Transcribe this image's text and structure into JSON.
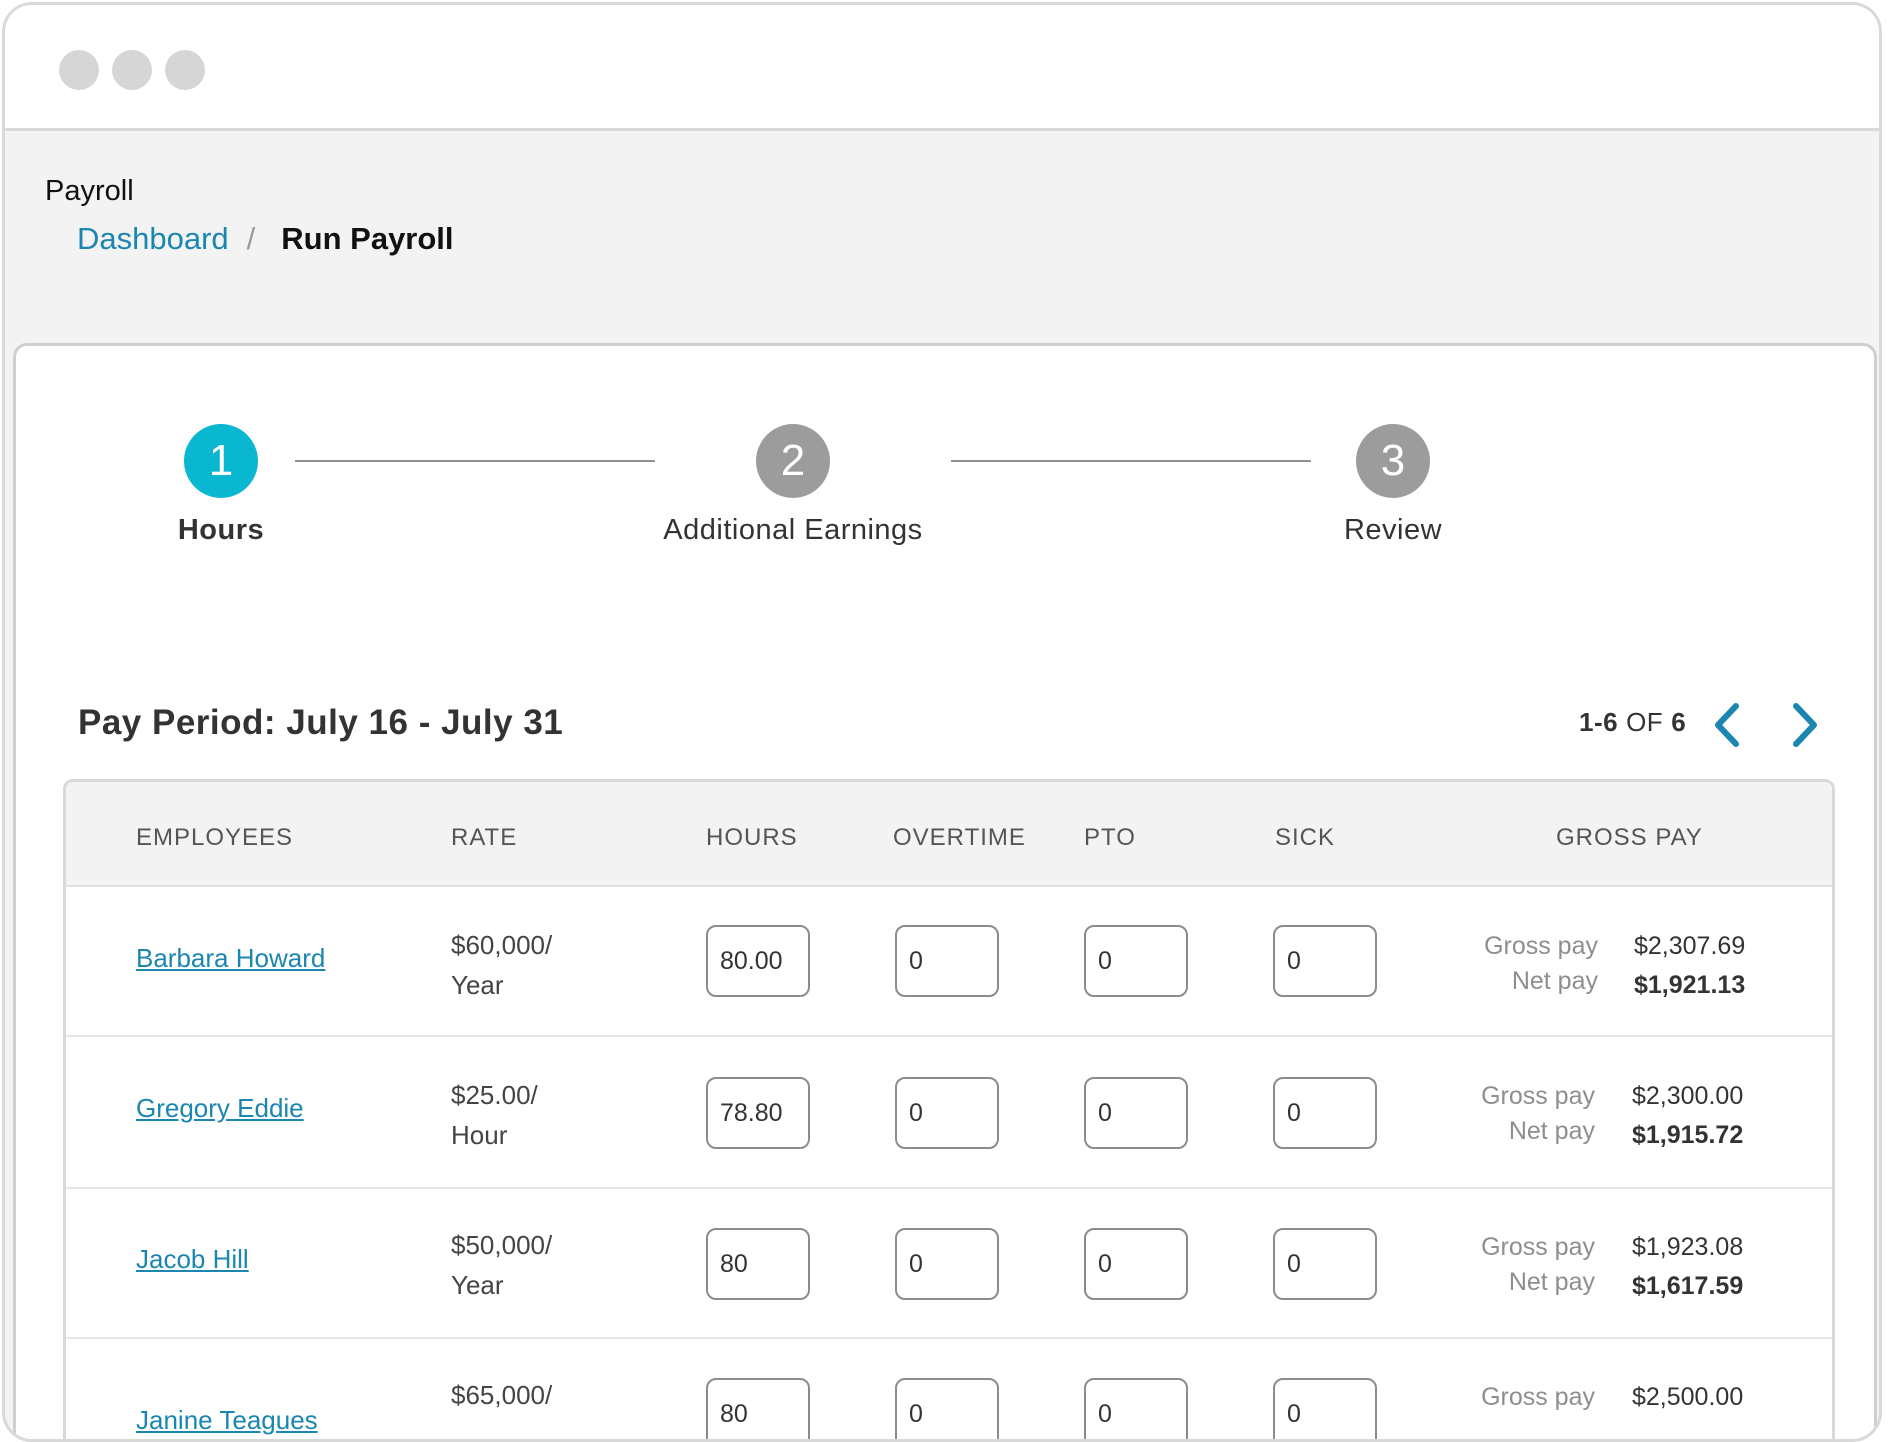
{
  "app": {
    "title": "Payroll",
    "breadcrumb": {
      "link": "Dashboard",
      "separator": "/",
      "current": "Run Payroll"
    }
  },
  "steps": [
    {
      "number": "1",
      "label": "Hours",
      "state": "active"
    },
    {
      "number": "2",
      "label": "Additional Earnings",
      "state": "inactive"
    },
    {
      "number": "3",
      "label": "Review",
      "state": "inactive"
    }
  ],
  "pay_period": {
    "title": "Pay Period: July 16 - July 31"
  },
  "pagination": {
    "range": "1-6",
    "of": "OF",
    "total": "6"
  },
  "table": {
    "headers": [
      "EMPLOYEES",
      "RATE",
      "HOURS",
      "OVERTIME",
      "PTO",
      "SICK",
      "GROSS PAY"
    ],
    "gross_label": "Gross pay",
    "net_label": "Net pay",
    "rows": [
      {
        "name": "Barbara Howard",
        "rate_amount": "$60,000/",
        "rate_unit": "Year",
        "hours": "80.00",
        "overtime": "0",
        "pto": "0",
        "sick": "0",
        "gross": "$2,307.69",
        "net": "$1,921.13"
      },
      {
        "name": "Gregory Eddie",
        "rate_amount": "$25.00/",
        "rate_unit": "Hour",
        "hours": "78.80",
        "overtime": "0",
        "pto": "0",
        "sick": "0",
        "gross": "$2,300.00",
        "net": "$1,915.72"
      },
      {
        "name": "Jacob Hill",
        "rate_amount": "$50,000/",
        "rate_unit": "Year",
        "hours": "80",
        "overtime": "0",
        "pto": "0",
        "sick": "0",
        "gross": "$1,923.08",
        "net": "$1,617.59"
      },
      {
        "name": "Janine Teagues",
        "rate_amount": "$65,000/",
        "rate_unit": "",
        "hours": "80",
        "overtime": "0",
        "pto": "0",
        "sick": "0",
        "gross": "$2,500.00",
        "net": ""
      }
    ]
  },
  "colors": {
    "accent": "#0ab7d0",
    "link": "#1b86b0",
    "inactive_step": "#9c9c9c"
  },
  "icons": {
    "prev": "chevron-left-icon",
    "next": "chevron-right-icon"
  }
}
